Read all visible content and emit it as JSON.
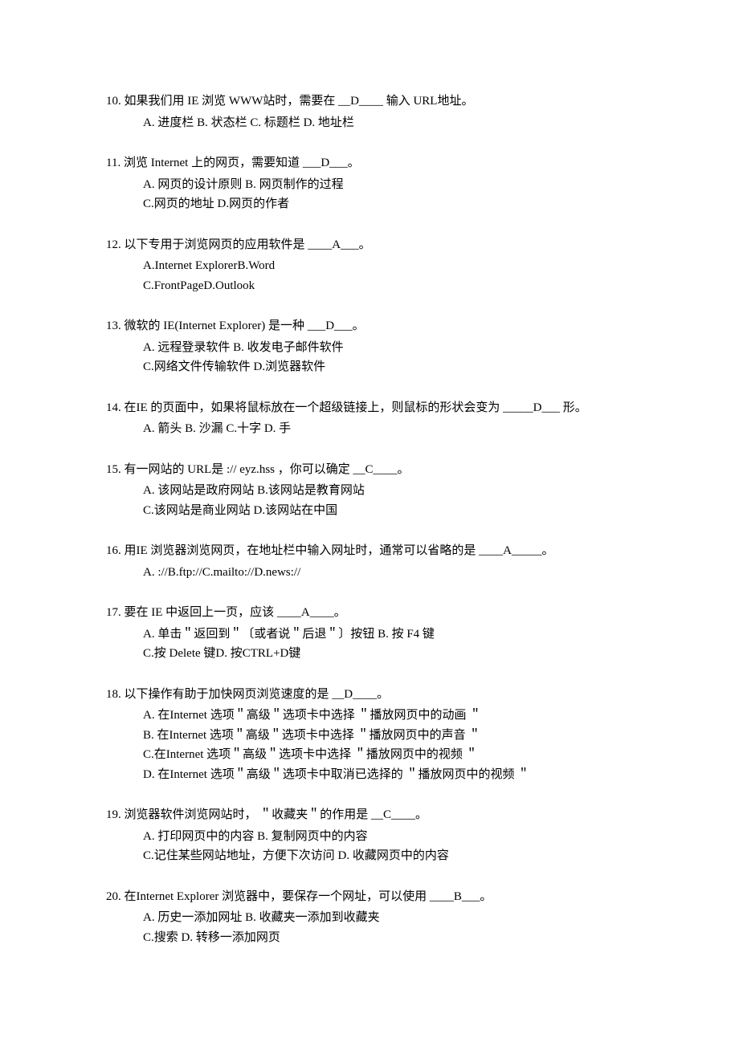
{
  "questions": [
    {
      "num": "10.",
      "stem": " 如果我们用  IE 浏览 WWW站时，需要在   __D____ 输入 URL地址。",
      "options": [
        "A. 进度栏 B. 状态栏 C. 标题栏 D. 地址栏"
      ]
    },
    {
      "num": "11.",
      "stem": " 浏览 Internet   上的网页，需要知道   ___D___。",
      "options": [
        "A. 网页的设计原则   B. 网页制作的过程",
        "C.网页的地址  D.网页的作者"
      ]
    },
    {
      "num": "12.",
      "stem": " 以下专用于浏览网页的应用软件是      ____A___。",
      "options": [
        "A.Internet ExplorerB.Word",
        "C.FrontPageD.Outlook"
      ]
    },
    {
      "num": "13.",
      "stem": " 微软的 IE(Internet Explorer)       是一种 ___D___。",
      "options": [
        "A. 远程登录软件        B.        收发电子邮件软件",
        "C.网络文件传输软件    D.浏览器软件"
      ]
    },
    {
      "num": "14.",
      "stem": " 在IE 的页面中，如果将鼠标放在一个超级链接上，则鼠标的形状会变为        _____D___ 形。",
      "options": [
        "A. 箭头 B. 沙漏 C.十字 D. 手"
      ]
    },
    {
      "num": "15.",
      "stem": " 有一网站的  URL是   ://   eyz.hss           ，你可以确定  __C____。",
      "options": [
        "A. 该网站是政府网站    B.该网站是教育网站",
        "C.该网站是商业网站    D.该网站在中国"
      ]
    },
    {
      "num": "16.",
      "stem": " 用IE 浏览器浏览网页，在地址栏中输入网址时，通常可以省略的是        ____A_____。",
      "options": [
        "A.    ://B.ftp://C.mailto://D.news://"
      ]
    },
    {
      "num": "17.",
      "stem": " 要在 IE 中返回上一页，应该  ____A____。",
      "options": [
        "A. 单击＂返回到＂〔或者说＂后退＂〕按钮 B. 按 F4 键",
        "C.按 Delete    键D. 按CTRL+D键"
      ]
    },
    {
      "num": "18.",
      "stem": " 以下操作有助于加快网页浏览速度的是     __D____。",
      "options": [
        "A. 在Internet   选项＂高级＂选项卡中选择  ＂播放网页中的动画   ＂",
        "B. 在Internet   选项＂高级＂选项卡中选择  ＂播放网页中的声音   ＂",
        "C.在Internet   选项＂高级＂选项卡中选择  ＂播放网页中的视频   ＂",
        "D. 在Internet   选项＂高级＂选项卡中取消已选择的   ＂播放网页中的视频   ＂"
      ]
    },
    {
      "num": "19.",
      "stem": " 浏览器软件浏览网站时，   ＂收藏夹＂的作用是  __C____。",
      "options": [
        "A. 打印网页中的内容    B. 复制网页中的内容",
        "C.记住某些网站地址，方便下次访问     D. 收藏网页中的内容"
      ]
    },
    {
      "num": "20.",
      "stem": " 在Internet Explorer     浏览器中，要保存一个网址，可以使用     ____B___。",
      "options": [
        "A. 历史一添加网址   B. 收藏夹一添加到收藏夹",
        "C.搜索 D. 转移一添加网页"
      ]
    }
  ]
}
